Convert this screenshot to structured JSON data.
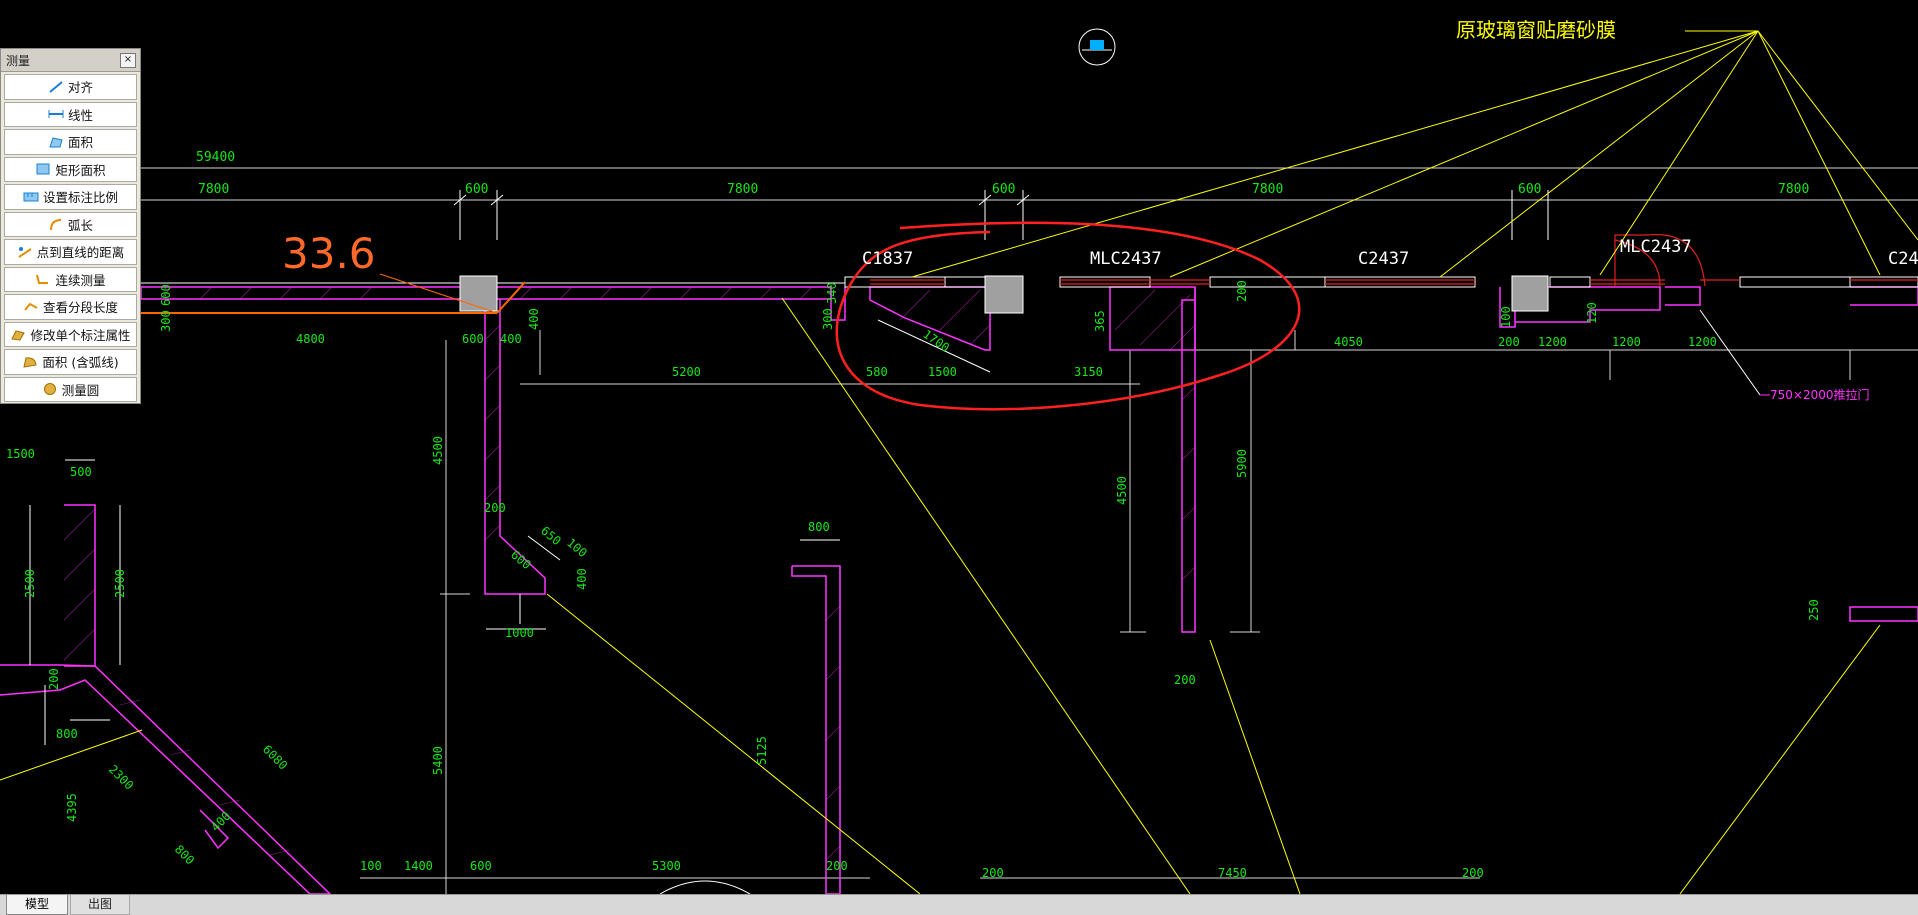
{
  "measure_panel": {
    "title": "测量",
    "close_label": "×",
    "items": [
      {
        "label": "对齐",
        "icon": "aligned-dimension-icon"
      },
      {
        "label": "线性",
        "icon": "linear-dimension-icon"
      },
      {
        "label": "面积",
        "icon": "area-icon"
      },
      {
        "label": "矩形面积",
        "icon": "rect-area-icon"
      },
      {
        "label": "设置标注比例",
        "icon": "scale-icon"
      },
      {
        "label": "弧长",
        "icon": "arc-length-icon"
      },
      {
        "label": "点到直线的距离",
        "icon": "point-line-distance-icon"
      },
      {
        "label": "连续测量",
        "icon": "continuous-measure-icon"
      },
      {
        "label": "查看分段长度",
        "icon": "segment-length-icon"
      },
      {
        "label": "修改单个标注属性",
        "icon": "edit-dimension-icon"
      },
      {
        "label": "面积 (含弧线)",
        "icon": "arc-area-icon"
      },
      {
        "label": "测量圆",
        "icon": "circle-measure-icon"
      }
    ]
  },
  "drawing": {
    "note_title": "原玻璃窗贴磨砂膜",
    "measure_readout": "33.6",
    "door_note": "750×2000推拉门",
    "labels": {
      "c1837": "C1837",
      "mlc1": "MLC2437",
      "c2437": "C2437",
      "mlc2": "MLC2437",
      "c24": "C24"
    },
    "overall_dim": "59400",
    "top_dims": [
      "7800",
      "600",
      "7800",
      "600",
      "7800",
      "600",
      "7800"
    ],
    "dims": {
      "d4800": "4800",
      "d600a": "600",
      "d400a": "400",
      "d5200": "5200",
      "d580": "580",
      "d1500": "1500",
      "d3150": "3150",
      "d4050": "4050",
      "d200a": "200",
      "d1200a": "1200",
      "d1200b": "1200",
      "d1200c": "1200",
      "d1700": "1700",
      "d4500a": "4500",
      "d4500b": "4500",
      "d5900": "5900",
      "d1500l": "1500",
      "d500": "500",
      "d2500a": "2500",
      "d2500b": "2500",
      "d800a": "800",
      "d200b": "200",
      "d650": "650",
      "d100": "100",
      "d600b": "600",
      "d400b": "400",
      "d1000": "1000",
      "d5400": "5400",
      "d5125": "5125",
      "d800b": "800",
      "d200c": "200",
      "d250": "250",
      "d100b": "100",
      "d1400": "1400",
      "d600c": "600",
      "d5300": "5300",
      "d200d": "200",
      "d200e": "200",
      "d7450": "7450",
      "d200f": "200",
      "d6080": "6080",
      "d2300": "2300",
      "d4395": "4395",
      "d200g": "200",
      "d800c": "800",
      "d400c": "400",
      "d600d": "600",
      "d300": "300",
      "d400d": "400",
      "d340": "340",
      "d365": "365",
      "d200h": "200",
      "d300b": "300",
      "d100c": "100",
      "d120": "120"
    }
  },
  "tabs": {
    "model": "模型",
    "print": "出图"
  }
}
